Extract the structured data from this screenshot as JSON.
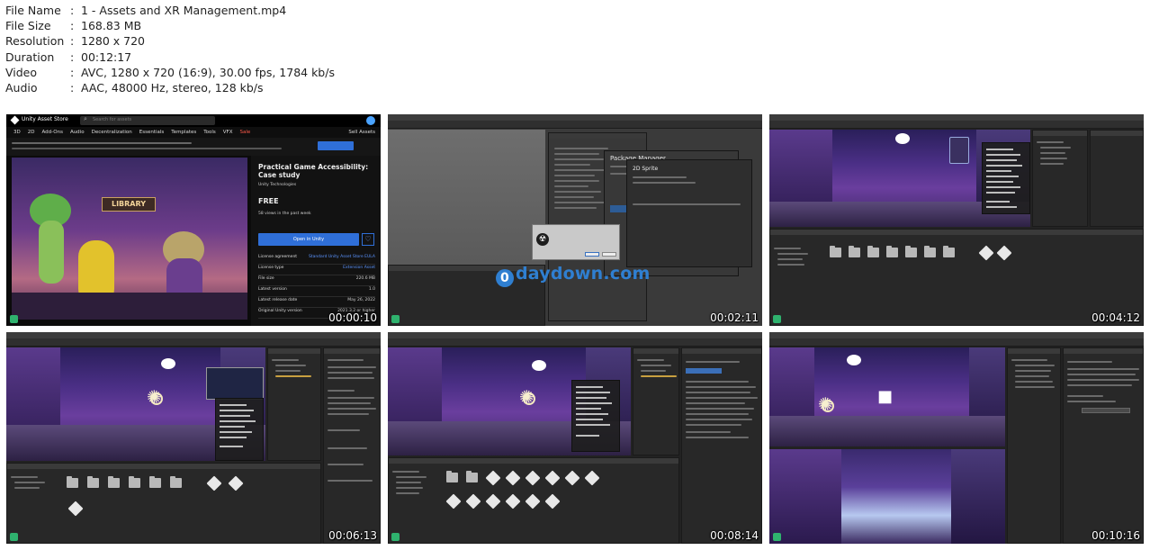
{
  "media_info": [
    {
      "key": "File Name",
      "value": "1 - Assets and XR Management.mp4"
    },
    {
      "key": "File Size",
      "value": "168.83 MB"
    },
    {
      "key": "Resolution",
      "value": "1280 x 720"
    },
    {
      "key": "Duration",
      "value": "00:12:17"
    },
    {
      "key": "Video",
      "value": "AVC, 1280 x 720 (16:9), 30.00 fps, 1784 kb/s"
    },
    {
      "key": "Audio",
      "value": "AAC, 48000 Hz, stereo, 128 kb/s"
    }
  ],
  "separator": ":",
  "thumbnails": [
    {
      "timestamp": "00:00:10"
    },
    {
      "timestamp": "00:02:11"
    },
    {
      "timestamp": "00:04:12"
    },
    {
      "timestamp": "00:06:13"
    },
    {
      "timestamp": "00:08:14"
    },
    {
      "timestamp": "00:10:16"
    }
  ],
  "asset_store": {
    "brand": "Unity Asset Store",
    "search_placeholder": "Search for assets",
    "nav": [
      "3D",
      "2D",
      "Add-Ons",
      "Audio",
      "Decentralization",
      "Essentials",
      "Templates",
      "Tools",
      "VFX",
      "Sale"
    ],
    "nav_right": "Sell Assets",
    "title": "Practical Game Accessibility: Case study",
    "author": "Unity Technologies",
    "price": "FREE",
    "views": "58 views in the past week",
    "cta": "Open in Unity",
    "art_sign": "LIBRARY",
    "details": [
      {
        "k": "License agreement",
        "v": "Standard Unity Asset Store EULA"
      },
      {
        "k": "License type",
        "v": "Extension Asset"
      },
      {
        "k": "File size",
        "v": "220.6 MB"
      },
      {
        "k": "Latest version",
        "v": "1.0"
      },
      {
        "k": "Latest release date",
        "v": "May 26, 2022"
      },
      {
        "k": "Original Unity version",
        "v": "2021.3.2 or higher"
      }
    ]
  },
  "package_manager": {
    "panel_title": "Package Manager",
    "package_name": "2D Sprite",
    "watermark": "daydown.com",
    "watermark_glyph": "0"
  },
  "colors": {
    "unity_bg": "#282828",
    "scene_violet": "#4b2f86",
    "store_button": "#2f6fd8",
    "watermark_blue": "#2f7fd1",
    "timestamp_text": "#ffffff"
  }
}
